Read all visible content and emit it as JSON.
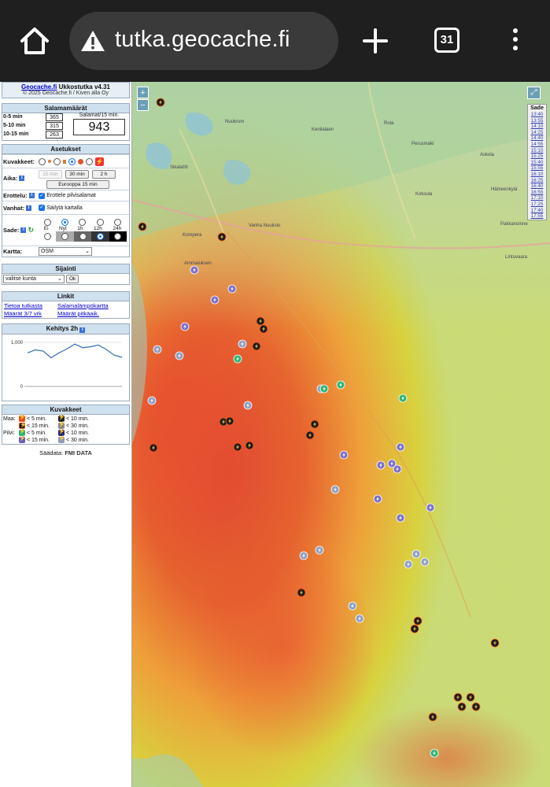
{
  "browser": {
    "url": "tutka.geocache.fi",
    "tab_count": "31"
  },
  "sidebar": {
    "title_link": "Geocache.fi",
    "title_rest": " Ukkostutka v4.31",
    "copyright": "© 2025 Geocache.fi / Kiven alla Oy",
    "counts": {
      "heading": "Salamamäärät",
      "rows": [
        {
          "label": "0-5 min",
          "value": "365"
        },
        {
          "label": "5-10 min",
          "value": "315"
        },
        {
          "label": "10-15 min",
          "value": "263"
        }
      ],
      "total_caption": "Salamat/15 min.",
      "total": "943"
    },
    "settings": {
      "heading": "Asetukset",
      "icons_label": "Kuvakkeet:",
      "time_label": "Aika:",
      "time_buttons": [
        "15 min",
        "30 min",
        "2 h"
      ],
      "europe_button": "Eurooppa 15 min",
      "separate_label": "Erottelu:",
      "separate_text": "Erottele pilvisalamat",
      "old_label": "Vanhat:",
      "old_text": "Säilytä kartalla",
      "rain_label": "Sade:",
      "rain_options": [
        "Ei",
        "Nyt",
        "1h",
        "12h",
        "24h"
      ],
      "map_label": "Kartta:",
      "map_value": "OSM"
    },
    "location": {
      "heading": "Sijainti",
      "select_placeholder": "valitse kunta",
      "ok": "Ok"
    },
    "links": {
      "heading": "Linkit",
      "items": [
        "Tietoa tutkasta",
        "Salamalämpökartta",
        "Määrät 3/7 vrk",
        "Määrät pitkäaik."
      ]
    },
    "trend": {
      "heading": "Kehitys 2h",
      "y_top": "1,000",
      "y_bottom": "0"
    },
    "legend": {
      "heading": "Kuvakkeet",
      "ground_label": "Maa:",
      "cloud_label": "Pilvi:",
      "lt5": "< 5 min.",
      "lt10": "< 10 min.",
      "lt15": "< 15 min.",
      "lt30": "< 30 min."
    },
    "weather_data_label": "Säädata:",
    "weather_data_source": "FMI DATA"
  },
  "map": {
    "rain_panel_heading": "Sade",
    "rain_times": [
      "13:40",
      "13:55",
      "14:10",
      "14:25",
      "14:40",
      "14:55",
      "15:10",
      "15:25",
      "15:40",
      "15:55",
      "16:10",
      "16:25",
      "16:40",
      "16:55",
      "17:10",
      "17:25",
      "17:40",
      "17:55"
    ],
    "place_labels": [
      "Nuukrum",
      "Rola",
      "Kenilalaen",
      "Perusmaki",
      "Askola",
      "Sikalahti",
      "Hämeenkylä",
      "Koksula",
      "Kompera",
      "Vanha Nuuksio",
      "Pakkanoinne",
      "Ammaluksen",
      "Lintuvaara"
    ],
    "zoom_in": "+",
    "zoom_out": "−",
    "colors": {
      "rain_red": "#e0552e",
      "rain_orange": "#ef9a33",
      "rain_yellow": "#d9d640",
      "ground_strike": "#1b1b1b",
      "cloud_strike": "#7a6fc8"
    }
  },
  "chart_data": {
    "type": "line",
    "title": "Kehitys 2h",
    "ylim": [
      0,
      1000
    ],
    "series": [
      {
        "values": [
          760,
          830,
          800,
          650,
          760,
          850,
          960,
          880,
          900,
          940,
          840,
          710,
          660
        ]
      }
    ]
  }
}
